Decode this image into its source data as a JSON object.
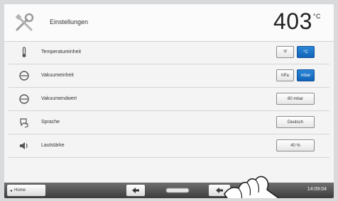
{
  "header": {
    "title": "Einstellungen",
    "temperature": "403",
    "temperature_unit": "°C"
  },
  "rows": [
    {
      "label": "Temperatureinheit",
      "icon": "thermometer-icon",
      "options": [
        "°F",
        "°C"
      ],
      "selected": "°C"
    },
    {
      "label": "Vakuumeinheit",
      "icon": "vacuum-gauge-icon",
      "options": [
        "hPa",
        "mbar"
      ],
      "selected": "mbar"
    },
    {
      "label": "Vakuumendwert",
      "icon": "vacuum-gauge-icon",
      "value": "80 mbar"
    },
    {
      "label": "Sprache",
      "icon": "language-icon",
      "value": "Deutsch"
    },
    {
      "label": "Lautstärke",
      "icon": "speaker-icon",
      "value": "40 %"
    }
  ],
  "footer": {
    "home_label": "Home",
    "time": "14:09:04"
  },
  "colors": {
    "accent": "#1b72c8",
    "footer": "#4a4a4a"
  }
}
